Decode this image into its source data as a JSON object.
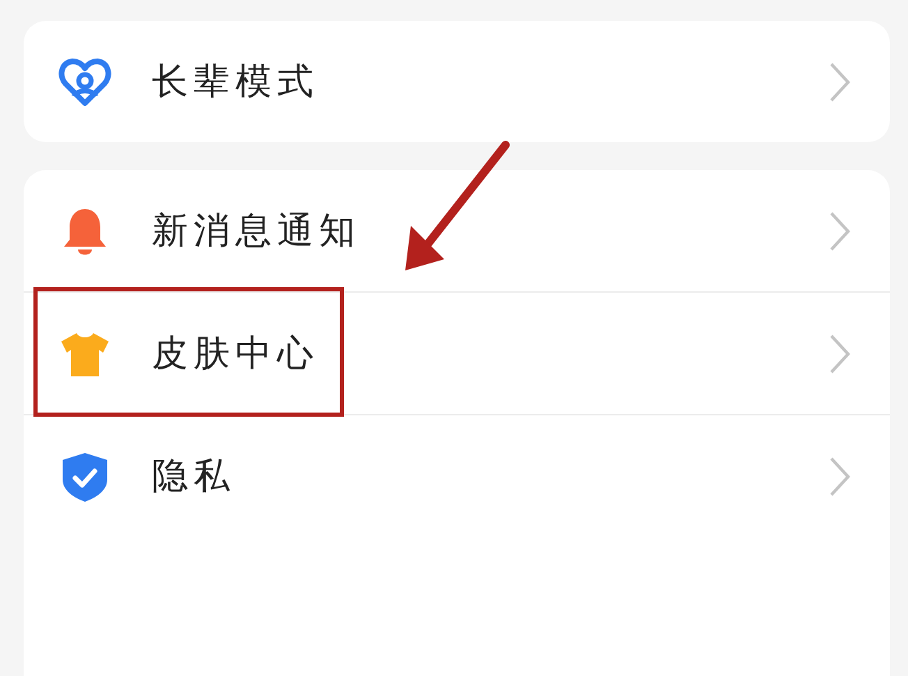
{
  "groups": [
    {
      "items": [
        {
          "label": "长辈模式",
          "highlighted": false
        }
      ]
    },
    {
      "items": [
        {
          "label": "新消息通知",
          "highlighted": false
        },
        {
          "label": "皮肤中心",
          "highlighted": true
        },
        {
          "label": "隐私",
          "highlighted": false
        }
      ]
    }
  ]
}
